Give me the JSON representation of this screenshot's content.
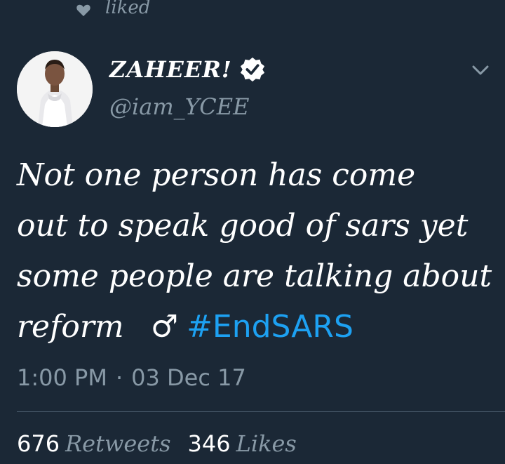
{
  "social_context": {
    "label": "liked",
    "icon": "heart-icon"
  },
  "author": {
    "display_name": "ZAHEER!",
    "handle": "@iam_YCEE",
    "verified_icon": "verified-badge-icon"
  },
  "tweet": {
    "text_lines": [
      "Not one person has come",
      "out to speak good of sars yet",
      "some people are talking about"
    ],
    "last_line_text": "reform",
    "emoji": "♂",
    "hashtag": "#EndSARS"
  },
  "meta": {
    "time": "1:00 PM",
    "separator": "·",
    "date": "03 Dec 17"
  },
  "stats": {
    "retweets_count": "676",
    "retweets_label": "Retweets",
    "likes_count": "346",
    "likes_label": "Likes"
  },
  "colors": {
    "background": "#1b2836",
    "text": "#ffffff",
    "muted": "#8899a6",
    "link": "#1da1f2"
  }
}
